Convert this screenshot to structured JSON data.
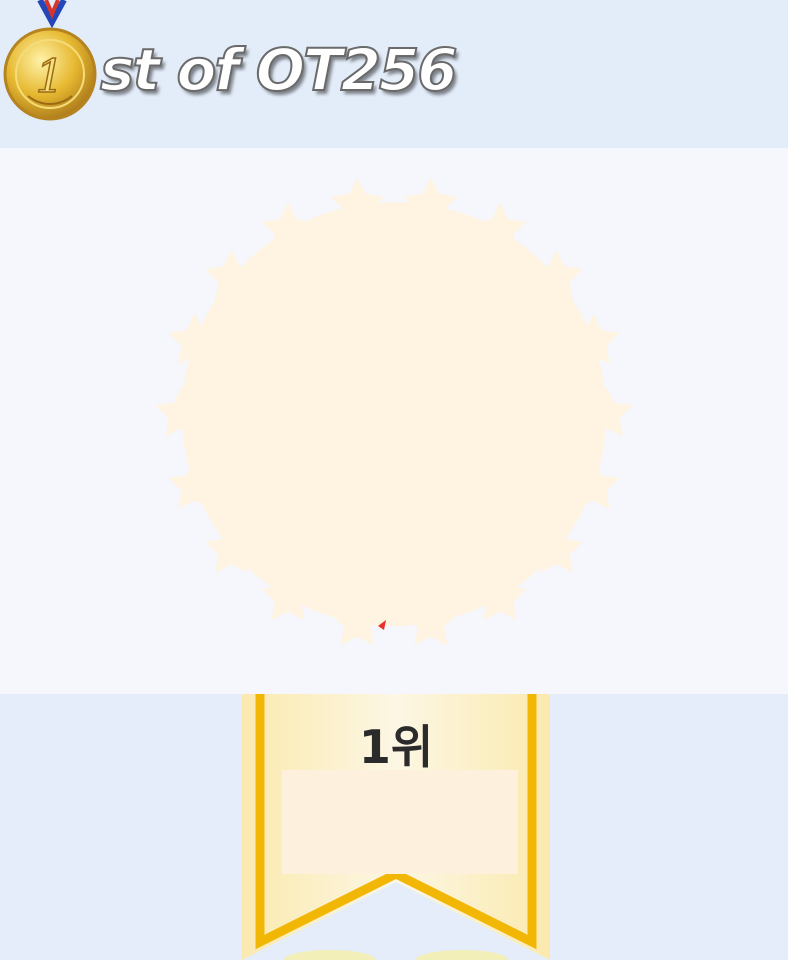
{
  "header": {
    "title": "st of OT256",
    "medal_label": "1"
  },
  "ranking": {
    "rank_label": "1위"
  },
  "colors": {
    "header_bg": "#e3ecf9",
    "panel_bg": "#f5f7fd",
    "badge_fill": "#fff3e1",
    "ribbon_gold": "#f2b705",
    "ribbon_fill": "#fff6d8"
  },
  "icons": {
    "medal": "gold-medal-icon",
    "badge": "star-burst-badge-icon",
    "ribbon": "rank-ribbon-icon"
  }
}
